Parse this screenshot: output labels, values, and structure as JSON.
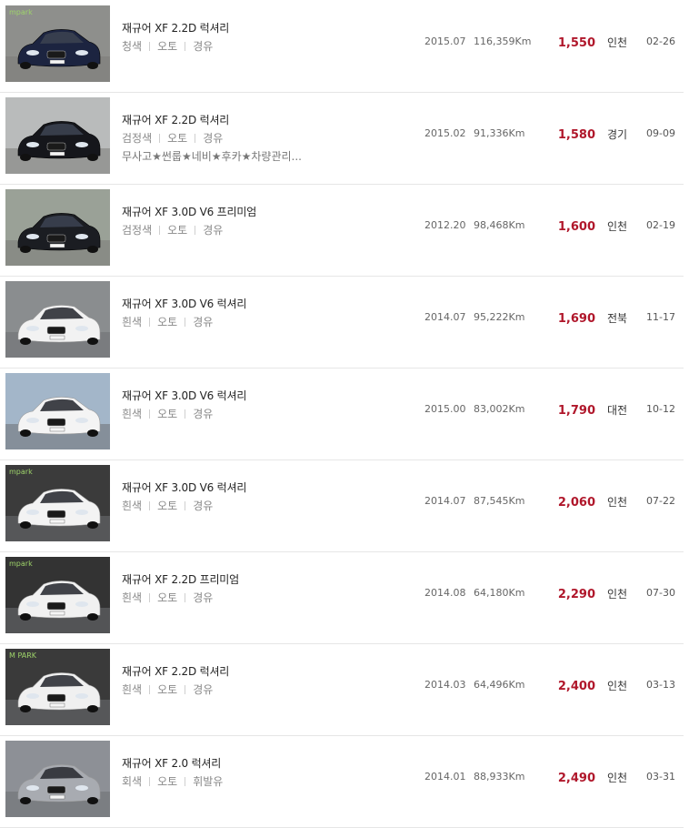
{
  "listings": [
    {
      "title": "재규어 XF 2.2D 럭셔리",
      "color": "청색",
      "transmission": "오토",
      "fuel": "경유",
      "description": "",
      "year": "2015.07",
      "mileage": "116,359Km",
      "price": "1,550",
      "region": "인천",
      "date": "02-26",
      "watermark": "mpark"
    },
    {
      "title": "재규어 XF 2.2D 럭셔리",
      "color": "검정색",
      "transmission": "오토",
      "fuel": "경유",
      "description": "무사고★썬룹★네비★후카★차량관리...",
      "year": "2015.02",
      "mileage": "91,336Km",
      "price": "1,580",
      "region": "경기",
      "date": "09-09",
      "watermark": ""
    },
    {
      "title": "재규어 XF 3.0D V6 프리미엄",
      "color": "검정색",
      "transmission": "오토",
      "fuel": "경유",
      "description": "",
      "year": "2012.20",
      "mileage": "98,468Km",
      "price": "1,600",
      "region": "인천",
      "date": "02-19",
      "watermark": ""
    },
    {
      "title": "재규어 XF 3.0D V6 럭셔리",
      "color": "흰색",
      "transmission": "오토",
      "fuel": "경유",
      "description": "",
      "year": "2014.07",
      "mileage": "95,222Km",
      "price": "1,690",
      "region": "전북",
      "date": "11-17",
      "watermark": ""
    },
    {
      "title": "재규어 XF 3.0D V6 럭셔리",
      "color": "흰색",
      "transmission": "오토",
      "fuel": "경유",
      "description": "",
      "year": "2015.00",
      "mileage": "83,002Km",
      "price": "1,790",
      "region": "대전",
      "date": "10-12",
      "watermark": ""
    },
    {
      "title": "재규어 XF 3.0D V6 럭셔리",
      "color": "흰색",
      "transmission": "오토",
      "fuel": "경유",
      "description": "",
      "year": "2014.07",
      "mileage": "87,545Km",
      "price": "2,060",
      "region": "인천",
      "date": "07-22",
      "watermark": "mpark"
    },
    {
      "title": "재규어 XF 2.2D 프리미엄",
      "color": "흰색",
      "transmission": "오토",
      "fuel": "경유",
      "description": "",
      "year": "2014.08",
      "mileage": "64,180Km",
      "price": "2,290",
      "region": "인천",
      "date": "07-30",
      "watermark": "mpark"
    },
    {
      "title": "재규어 XF 2.2D 럭셔리",
      "color": "흰색",
      "transmission": "오토",
      "fuel": "경유",
      "description": "",
      "year": "2014.03",
      "mileage": "64,496Km",
      "price": "2,400",
      "region": "인천",
      "date": "03-13",
      "watermark": "M PARK"
    },
    {
      "title": "재규어 XF 2.0 럭셔리",
      "color": "회색",
      "transmission": "오토",
      "fuel": "휘발유",
      "description": "",
      "year": "2014.01",
      "mileage": "88,933Km",
      "price": "2,490",
      "region": "인천",
      "date": "03-31",
      "watermark": ""
    }
  ],
  "theme": {
    "price_color": "#b0172b",
    "car_colors": [
      "#1c2440",
      "#15161b",
      "#1b1d22",
      "#f2f2f2",
      "#f4f4f4",
      "#f3f3f3",
      "#f1f1f1",
      "#f0f0f0",
      "#a8abb1"
    ],
    "backgrounds": [
      "#8e8f8c",
      "#b9bbbb",
      "#9aa197",
      "#8a8d8f",
      "#a3b6c9",
      "#3b3b3b",
      "#333333",
      "#3a3a3a",
      "#8d9096"
    ]
  }
}
